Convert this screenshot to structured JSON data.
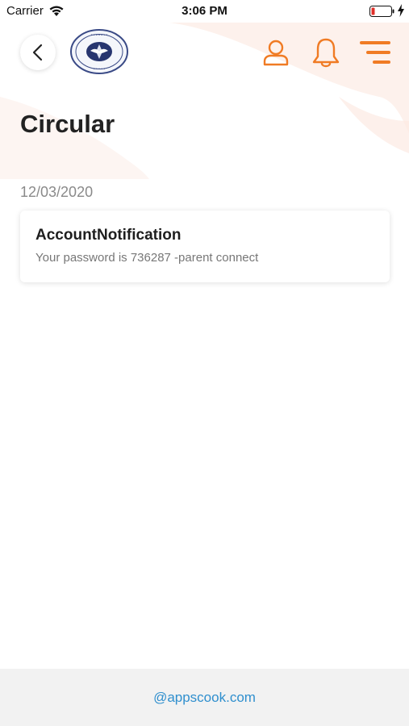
{
  "status_bar": {
    "carrier": "Carrier",
    "time": "3:06 PM"
  },
  "header": {
    "back_icon": "chevron-left-icon",
    "logo_icon": "school-crest-logo",
    "profile_icon": "user-icon",
    "notification_icon": "bell-icon",
    "menu_icon": "menu-lines-icon",
    "accent_color": "#F07B24"
  },
  "page": {
    "title": "Circular"
  },
  "circulars": [
    {
      "date": "12/03/2020",
      "title": "AccountNotification",
      "message": "Your password is 736287 -parent connect"
    }
  ],
  "footer": {
    "link": "@appscook.com",
    "link_color": "#2F8FCE"
  }
}
